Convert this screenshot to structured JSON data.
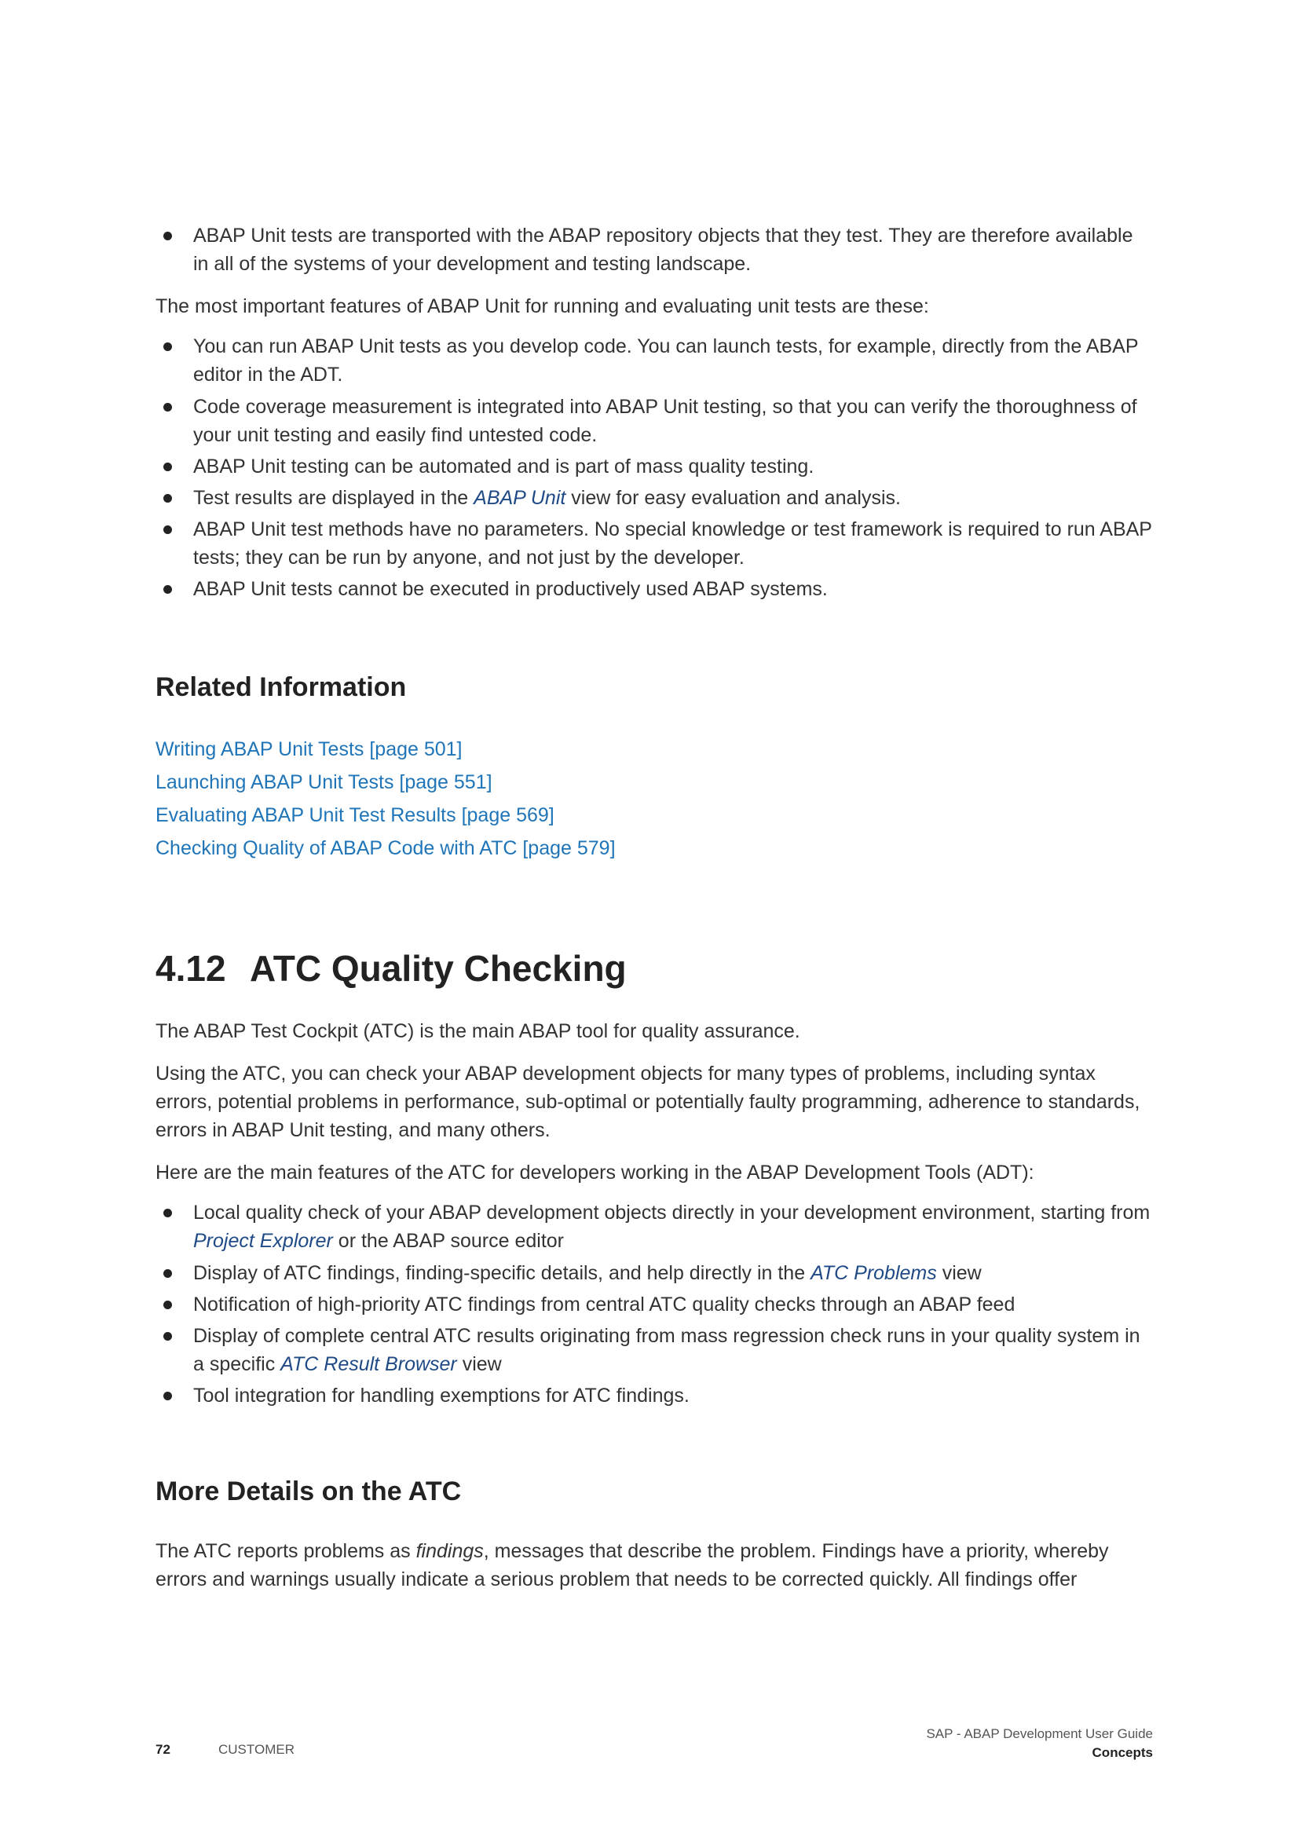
{
  "intro_bullet": {
    "text": "ABAP Unit tests are transported with the ABAP repository objects that they test. They are therefore available in all of the systems of your development and testing landscape."
  },
  "features_intro": "The most important features of ABAP Unit for running and evaluating unit tests are these:",
  "features": {
    "item1": "You can run ABAP Unit tests as you develop code. You can launch tests, for example, directly from the ABAP editor in the ADT.",
    "item2": "Code coverage measurement is integrated into ABAP Unit testing, so that you can verify the thoroughness of your unit testing and easily find untested code.",
    "item3": "ABAP Unit testing can be automated and is part of mass quality testing.",
    "item4_pre": "Test results are displayed in the ",
    "item4_term": "ABAP Unit",
    "item4_post": " view for easy evaluation and analysis.",
    "item5": "ABAP Unit test methods have no parameters. No special knowledge or test framework is required to run ABAP tests; they can be run by anyone, and not just by the developer.",
    "item6": "ABAP Unit tests cannot be executed in productively used ABAP systems."
  },
  "related": {
    "heading": "Related Information",
    "links": [
      "Writing ABAP Unit Tests [page 501]",
      "Launching ABAP Unit Tests [page 551]",
      "Evaluating ABAP Unit Test Results [page 569]",
      "Checking Quality of ABAP Code with ATC [page 579]"
    ]
  },
  "section": {
    "number": "4.12",
    "title": "ATC Quality Checking",
    "para1": "The ABAP Test Cockpit (ATC) is the main ABAP tool for quality assurance.",
    "para2": "Using the ATC, you can check your ABAP development objects for many types of problems, including syntax errors, potential problems in performance, sub-optimal or potentially faulty programming, adherence to standards, errors in ABAP Unit testing, and many others.",
    "para3": "Here are the main features of the ATC for developers working in the ABAP Development Tools (ADT):"
  },
  "atc_features": {
    "item1_pre": "Local quality check of your ABAP development objects directly in your development environment, starting from ",
    "item1_term": "Project Explorer",
    "item1_post": " or the ABAP source editor",
    "item2_pre": "Display of ATC findings, finding-specific details, and help directly in the ",
    "item2_term": "ATC Problems",
    "item2_post": " view",
    "item3": "Notification of high-priority ATC findings from central ATC quality checks through an ABAP feed",
    "item4_pre": "Display of complete central ATC results originating from mass regression check runs in your quality system in a specific ",
    "item4_term": "ATC Result Browser",
    "item4_post": " view",
    "item5": "Tool integration for handling exemptions for ATC findings."
  },
  "more_details": {
    "heading": "More Details on the ATC",
    "para_pre": "The ATC reports problems as ",
    "para_emph": "findings",
    "para_post": ", messages that describe the problem. Findings have a priority, whereby errors and warnings usually indicate a serious problem that needs to be corrected quickly. All findings offer"
  },
  "footer": {
    "page_number": "72",
    "classification": "CUSTOMER",
    "doc_title": "SAP - ABAP Development User Guide",
    "section_name": "Concepts"
  }
}
